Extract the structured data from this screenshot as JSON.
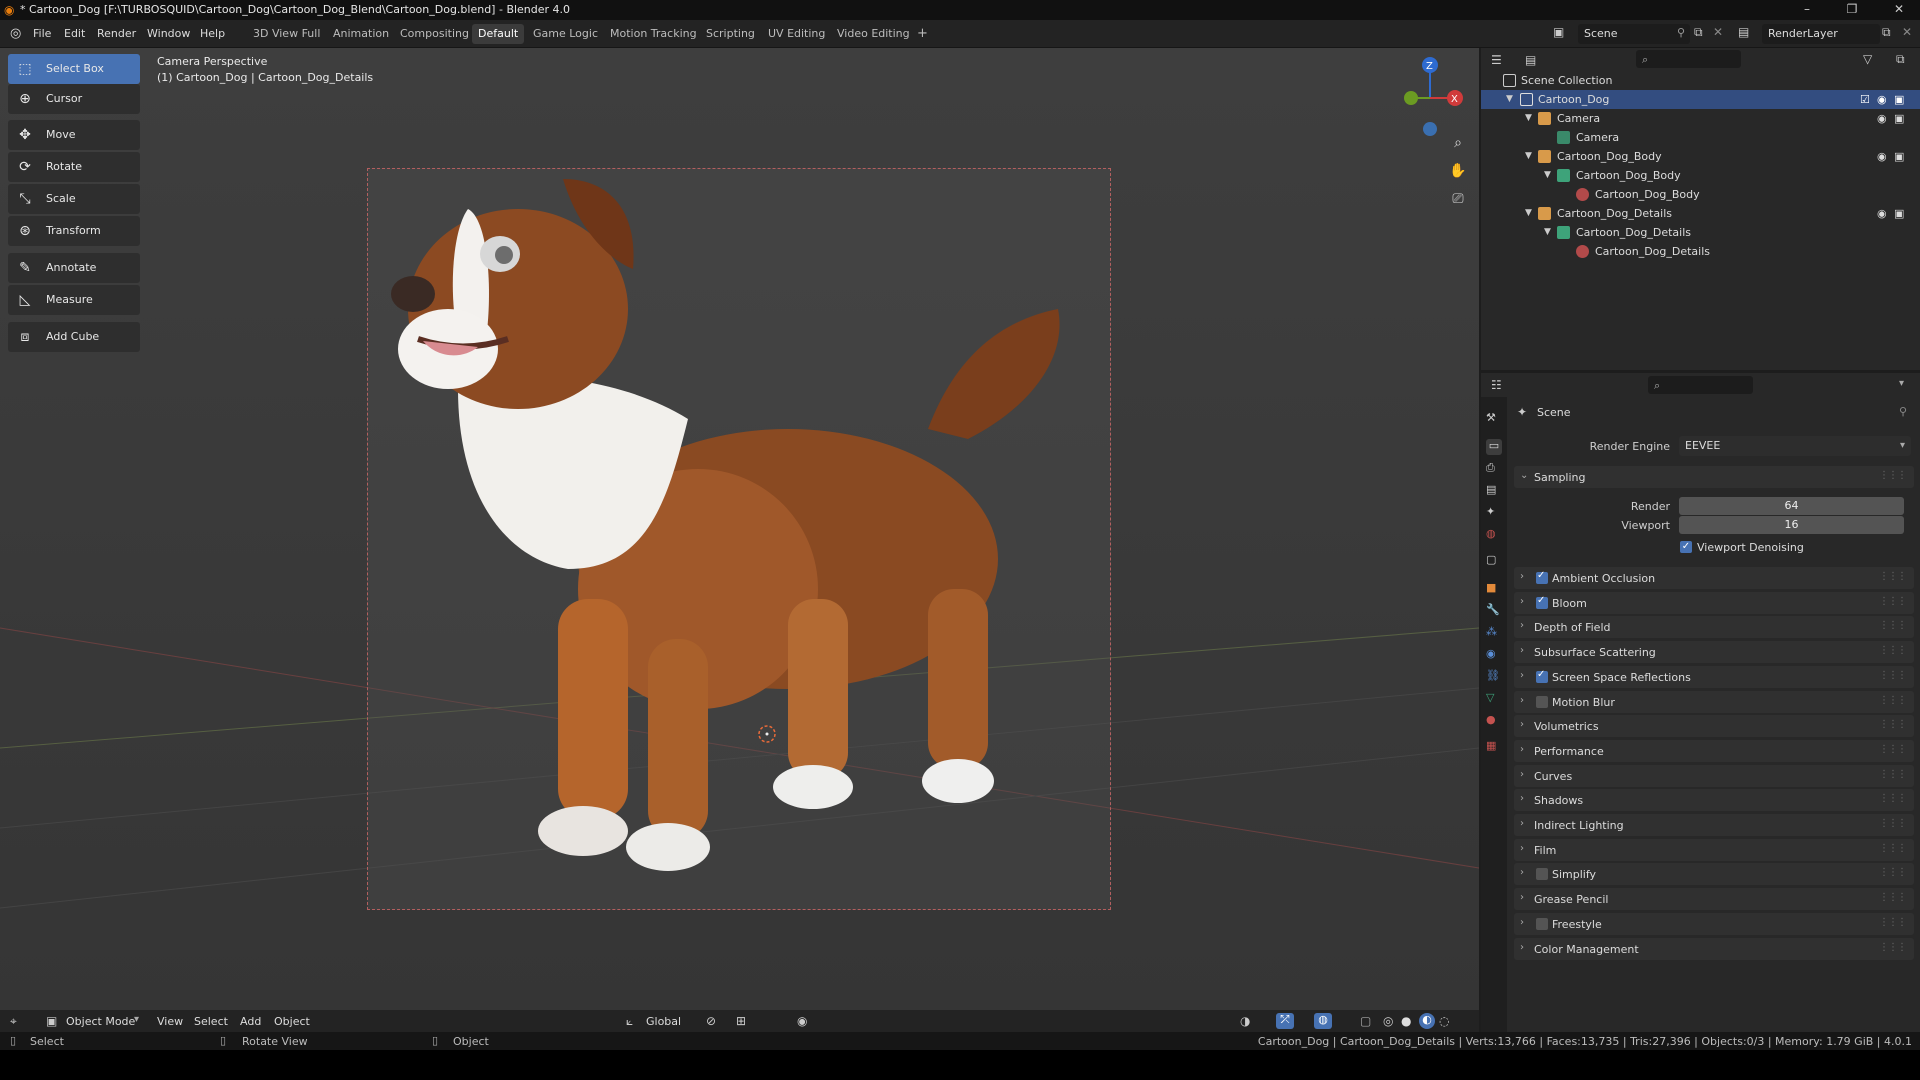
{
  "window": {
    "title": "* Cartoon_Dog [F:\\TURBOSQUID\\Cartoon_Dog\\Cartoon_Dog_Blend\\Cartoon_Dog.blend] - Blender 4.0"
  },
  "menu": [
    "File",
    "Edit",
    "Render",
    "Window",
    "Help"
  ],
  "workspaces": [
    "3D View Full",
    "Animation",
    "Compositing",
    "Default",
    "Game Logic",
    "Motion Tracking",
    "Scripting",
    "UV Editing",
    "Video Editing"
  ],
  "active_workspace": "Default",
  "scene_field": "Scene",
  "renderlayer_field": "RenderLayer",
  "viewport": {
    "overlay_line1": "Camera Perspective",
    "overlay_line2": "(1) Cartoon_Dog | Cartoon_Dog_Details",
    "gizmo_z": "Z",
    "gizmo_x": "X"
  },
  "toolbar": [
    {
      "label": "Select Box",
      "icon": "select-box-icon"
    },
    {
      "label": "Cursor",
      "icon": "cursor-icon"
    },
    {
      "label": "Move",
      "icon": "move-icon"
    },
    {
      "label": "Rotate",
      "icon": "rotate-icon"
    },
    {
      "label": "Scale",
      "icon": "scale-icon"
    },
    {
      "label": "Transform",
      "icon": "transform-icon"
    },
    {
      "label": "Annotate",
      "icon": "annotate-icon"
    },
    {
      "label": "Measure",
      "icon": "measure-icon"
    },
    {
      "label": "Add Cube",
      "icon": "add-cube-icon"
    }
  ],
  "vp_header": {
    "mode": "Object Mode",
    "menus": [
      "View",
      "Select",
      "Add",
      "Object"
    ],
    "orientation": "Global"
  },
  "outliner": {
    "root": "Scene Collection",
    "items": [
      {
        "label": "Cartoon_Dog",
        "depth": 1,
        "selected": true
      },
      {
        "label": "Camera",
        "depth": 2
      },
      {
        "label": "Camera",
        "depth": 3
      },
      {
        "label": "Cartoon_Dog_Body",
        "depth": 2
      },
      {
        "label": "Cartoon_Dog_Body",
        "depth": 3
      },
      {
        "label": "Cartoon_Dog_Body",
        "depth": 4
      },
      {
        "label": "Cartoon_Dog_Details",
        "depth": 2
      },
      {
        "label": "Cartoon_Dog_Details",
        "depth": 3
      },
      {
        "label": "Cartoon_Dog_Details",
        "depth": 4
      }
    ]
  },
  "properties": {
    "context": "Scene",
    "render_engine_label": "Render Engine",
    "render_engine": "EEVEE",
    "sampling": "Sampling",
    "render_label": "Render",
    "render_value": "64",
    "viewport_label": "Viewport",
    "viewport_value": "16",
    "viewport_denoising": "Viewport Denoising",
    "panels": [
      {
        "label": "Ambient Occlusion",
        "checkbox": true,
        "checked": true
      },
      {
        "label": "Bloom",
        "checkbox": true,
        "checked": true
      },
      {
        "label": "Depth of Field",
        "checkbox": false
      },
      {
        "label": "Subsurface Scattering",
        "checkbox": false
      },
      {
        "label": "Screen Space Reflections",
        "checkbox": true,
        "checked": true
      },
      {
        "label": "Motion Blur",
        "checkbox": true,
        "checked": false
      },
      {
        "label": "Volumetrics",
        "checkbox": false
      },
      {
        "label": "Performance",
        "checkbox": false
      },
      {
        "label": "Curves",
        "checkbox": false
      },
      {
        "label": "Shadows",
        "checkbox": false
      },
      {
        "label": "Indirect Lighting",
        "checkbox": false
      },
      {
        "label": "Film",
        "checkbox": false
      },
      {
        "label": "Simplify",
        "checkbox": true,
        "checked": false
      },
      {
        "label": "Grease Pencil",
        "checkbox": false
      },
      {
        "label": "Freestyle",
        "checkbox": true,
        "checked": false
      },
      {
        "label": "Color Management",
        "checkbox": false
      }
    ]
  },
  "status": {
    "left1": "Select",
    "left2": "Rotate View",
    "left3": "Object",
    "right": "Cartoon_Dog | Cartoon_Dog_Details | Verts:13,766 | Faces:13,735 | Tris:27,396 | Objects:0/3 | Memory: 1.79 GiB | 4.0.1"
  },
  "colors": {
    "accent": "#4772b3",
    "selection": "#334d80",
    "camera_frame": "#b35f5f"
  }
}
